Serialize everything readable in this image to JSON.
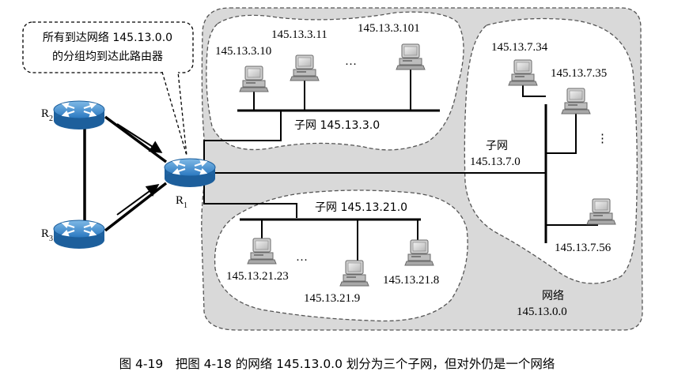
{
  "callout": {
    "line1": "所有到达网络 145.13.0.0",
    "line2": "的分组均到达此路由器"
  },
  "routers": {
    "r1": {
      "letter": "R",
      "sub": "1"
    },
    "r2": {
      "letter": "R",
      "sub": "2"
    },
    "r3": {
      "letter": "R",
      "sub": "3"
    }
  },
  "subnet3": {
    "label": "子网 145.13.3.0",
    "hosts": [
      "145.13.3.10",
      "145.13.3.11",
      "145.13.3.101"
    ],
    "ellipsis": "…"
  },
  "subnet7": {
    "label_line1": "子网",
    "label_line2": "145.13.7.0",
    "hosts": [
      "145.13.7.34",
      "145.13.7.35",
      "145.13.7.56"
    ],
    "ellipsis": "⋮"
  },
  "subnet21": {
    "label": "子网 145.13.21.0",
    "hosts": [
      "145.13.21.23",
      "145.13.21.9",
      "145.13.21.8"
    ],
    "ellipsis": "…"
  },
  "network": {
    "label_line1": "网络",
    "label_line2": "145.13.0.0"
  },
  "caption": "图 4-19　把图 4-18 的网络 145.13.0.0 划分为三个子网，但对外仍是一个网络",
  "colors": {
    "router_blue": "#2a78c0",
    "network_gray": "#d9d9d9",
    "host_gray": "#9a9a9a"
  }
}
